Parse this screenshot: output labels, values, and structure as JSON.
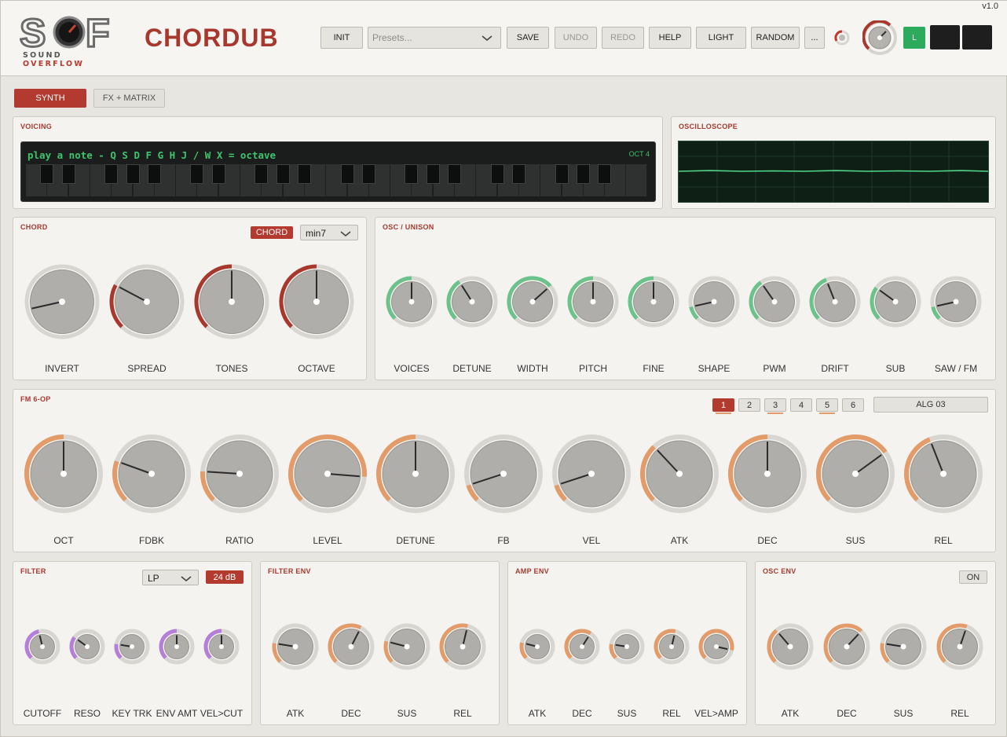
{
  "header": {
    "logo_letters": "SOF",
    "logo_word1": "SOUND",
    "logo_word2": "OVERFLOW",
    "title": "CHORDUB",
    "version": "v1.0",
    "buttons": {
      "init": "INIT",
      "save": "SAVE",
      "undo": "UNDO",
      "redo": "REDO",
      "help": "HELP",
      "light": "LIGHT",
      "random": "RANDOM",
      "more": "..."
    },
    "preset_placeholder": "Presets...",
    "l_button": "L",
    "master_knob_value": 0.62
  },
  "tabs": {
    "synth": "SYNTH",
    "fx_matrix": "FX + MATRIX",
    "active": "synth"
  },
  "voicing": {
    "title": "VOICING",
    "hint": "play a note  -  Q S D F G H J  /  W X = octave",
    "octave": "OCT 4"
  },
  "oscilloscope": {
    "title": "OSCILLOSCOPE"
  },
  "chord": {
    "title": "CHORD",
    "mode_badge": "CHORD",
    "type": "min7",
    "knobs": [
      {
        "label": "INVERT",
        "value": 0.12,
        "arc": false
      },
      {
        "label": "SPREAD",
        "value": 0.27,
        "arc": true
      },
      {
        "label": "TONES",
        "value": 0.5,
        "arc": true
      },
      {
        "label": "OCTAVE",
        "value": 0.5,
        "arc": true
      }
    ],
    "arc_color": "#a8382d"
  },
  "osc": {
    "title": "OSC / UNISON",
    "knobs": [
      {
        "label": "VOICES",
        "value": 0.5
      },
      {
        "label": "DETUNE",
        "value": 0.38
      },
      {
        "label": "WIDTH",
        "value": 0.68
      },
      {
        "label": "PITCH",
        "value": 0.5
      },
      {
        "label": "FINE",
        "value": 0.5
      },
      {
        "label": "SHAPE",
        "value": 0.12
      },
      {
        "label": "PWM",
        "value": 0.37
      },
      {
        "label": "DRIFT",
        "value": 0.42
      },
      {
        "label": "SUB",
        "value": 0.3
      },
      {
        "label": "SAW / FM",
        "value": 0.12
      }
    ],
    "arc_color": "#6cc28b"
  },
  "fm": {
    "title": "FM  6-OP",
    "operators": [
      "1",
      "2",
      "3",
      "4",
      "5",
      "6"
    ],
    "selected_operator": "1",
    "active_operators": [
      "1",
      "3",
      "5"
    ],
    "algorithm": "ALG 03",
    "knobs": [
      {
        "label": "OCT",
        "value": 0.5
      },
      {
        "label": "FDBK",
        "value": 0.24
      },
      {
        "label": "RATIO",
        "value": 0.18
      },
      {
        "label": "LEVEL",
        "value": 0.85
      },
      {
        "label": "DETUNE",
        "value": 0.5
      },
      {
        "label": "FB",
        "value": 0.1
      },
      {
        "label": "VEL",
        "value": 0.1
      },
      {
        "label": "ATK",
        "value": 0.34
      },
      {
        "label": "DEC",
        "value": 0.5
      },
      {
        "label": "SUS",
        "value": 0.7
      },
      {
        "label": "REL",
        "value": 0.42
      }
    ],
    "arc_color": "#e39b6a"
  },
  "filter": {
    "title": "FILTER",
    "type": "LP",
    "slope": "24 dB",
    "knobs": [
      {
        "label": "CUTOFF",
        "value": 0.45
      },
      {
        "label": "RESO",
        "value": 0.3
      },
      {
        "label": "KEY TRK",
        "value": 0.2
      },
      {
        "label": "ENV AMT",
        "value": 0.5
      },
      {
        "label": "VEL>CUT",
        "value": 0.5
      }
    ],
    "arc_color": "#b57ed8"
  },
  "filter_env": {
    "title": "FILTER ENV",
    "knobs": [
      {
        "label": "ATK",
        "value": 0.2
      },
      {
        "label": "DEC",
        "value": 0.6
      },
      {
        "label": "SUS",
        "value": 0.22
      },
      {
        "label": "REL",
        "value": 0.55
      }
    ],
    "arc_color": "#e39b6a"
  },
  "amp_env": {
    "title": "AMP ENV",
    "knobs": [
      {
        "label": "ATK",
        "value": 0.22
      },
      {
        "label": "DEC",
        "value": 0.62
      },
      {
        "label": "SUS",
        "value": 0.2
      },
      {
        "label": "REL",
        "value": 0.55
      },
      {
        "label": "VEL>AMP",
        "value": 0.88
      }
    ],
    "arc_color": "#e39b6a"
  },
  "osc_env": {
    "title": "OSC ENV",
    "toggle": "ON",
    "knobs": [
      {
        "label": "ATK",
        "value": 0.35
      },
      {
        "label": "DEC",
        "value": 0.66
      },
      {
        "label": "SUS",
        "value": 0.2
      },
      {
        "label": "REL",
        "value": 0.57
      }
    ],
    "arc_color": "#e39b6a"
  }
}
